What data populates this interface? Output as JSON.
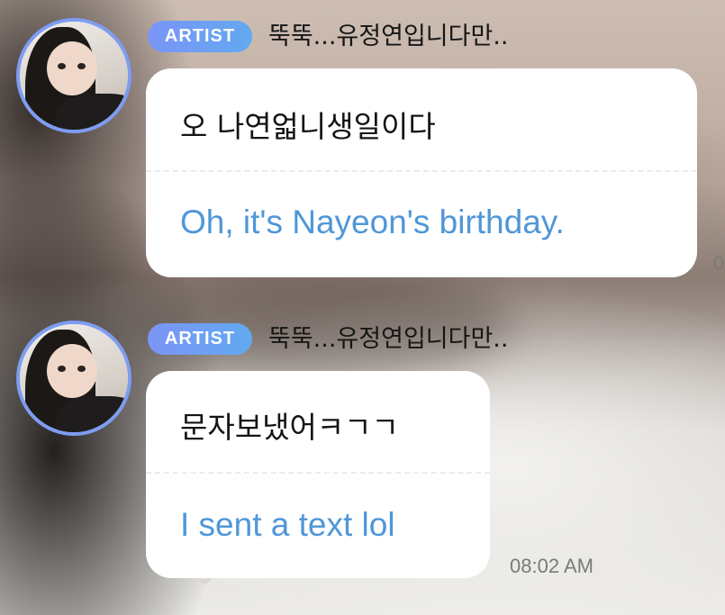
{
  "messages": [
    {
      "badge": "ARTIST",
      "sender": "뚝뚝...유정연입니다만..",
      "original": "오 나연얿니생일이다",
      "translation": "Oh, it's Nayeon's birthday.",
      "time": "0"
    },
    {
      "badge": "ARTIST",
      "sender": "뚝뚝...유정연입니다만..",
      "original": "문자보냈어ㅋㄱㄱ",
      "translation": "I sent a text lol",
      "time": "08:02 AM"
    }
  ],
  "colors": {
    "avatar_ring": "#7d9cf3",
    "badge_start": "#7b95f7",
    "badge_end": "#62a9f0",
    "translation_text": "#4f97d8",
    "bubble": "#ffffff"
  }
}
